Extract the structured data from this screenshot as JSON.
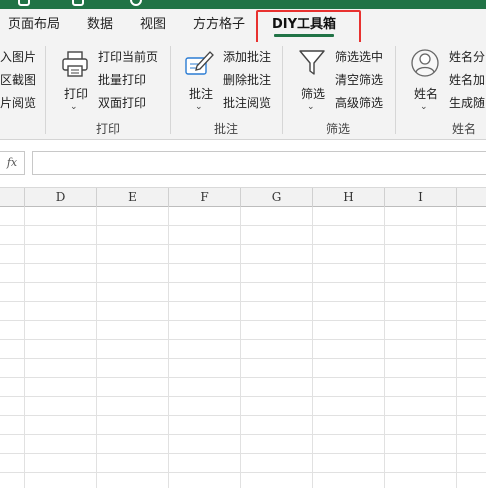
{
  "colors": {
    "brand_green": "#217346",
    "highlight_red": "#e8312f"
  },
  "tabs": [
    {
      "label": "页面布局"
    },
    {
      "label": "数据"
    },
    {
      "label": "视图"
    },
    {
      "label": "方方格子"
    },
    {
      "label": "DIY工具箱",
      "active": true
    }
  ],
  "ribbon": {
    "partial_group": {
      "items": [
        "入图片",
        "区截图",
        "片阅览"
      ]
    },
    "print_group": {
      "big_button": "打印",
      "big_button_icon": "printer-icon",
      "items": [
        "打印当前页",
        "批量打印",
        "双面打印"
      ],
      "label": "打印"
    },
    "comment_group": {
      "big_button": "批注",
      "big_button_icon": "pen-note-icon",
      "items": [
        "添加批注",
        "删除批注",
        "批注阅览"
      ],
      "label": "批注"
    },
    "filter_group": {
      "big_button": "筛选",
      "big_button_icon": "funnel-icon",
      "items": [
        "筛选选中",
        "清空筛选",
        "高级筛选"
      ],
      "label": "筛选"
    },
    "name_group": {
      "big_button": "姓名",
      "big_button_icon": "person-icon",
      "items": [
        "姓名分",
        "姓名加",
        "生成随"
      ],
      "label": "姓名"
    }
  },
  "formula_bar": {
    "fx_label": "fx",
    "value": ""
  },
  "grid": {
    "columns": [
      "D",
      "E",
      "F",
      "G",
      "H",
      "I"
    ]
  }
}
